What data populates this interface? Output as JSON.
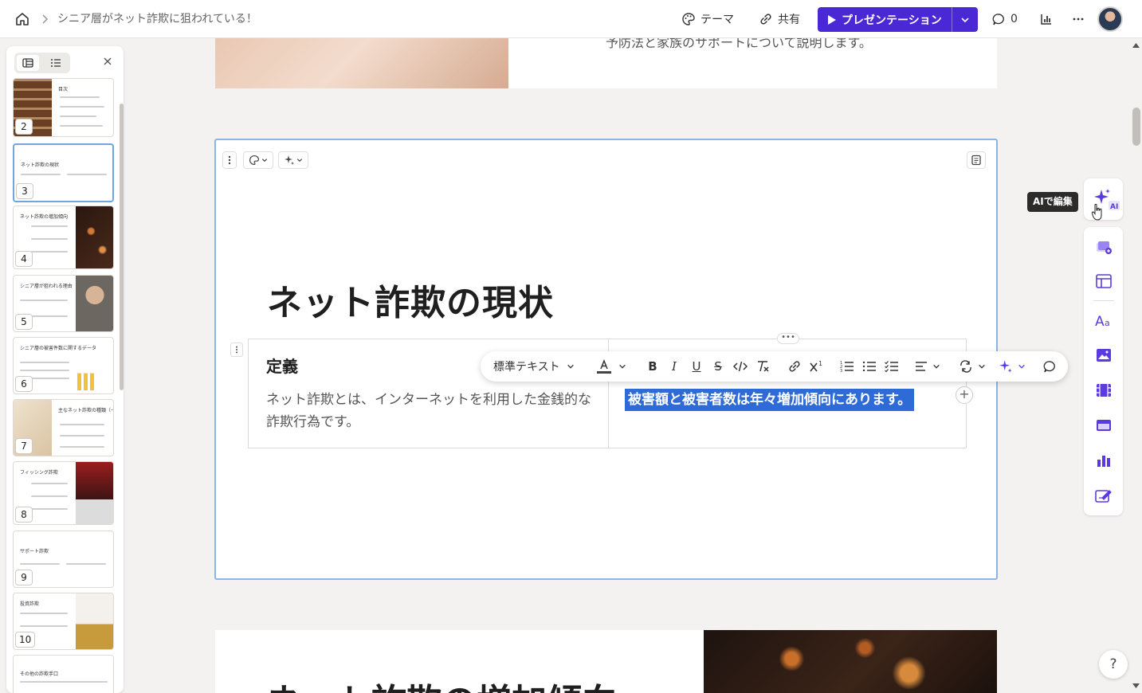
{
  "header": {
    "breadcrumb_title": "シニア層がネット詐欺に狙われている！",
    "theme_label": "テーマ",
    "share_label": "共有",
    "present_label": "プレゼンテーション",
    "comment_count": "0"
  },
  "thumbnails": [
    {
      "num": "2",
      "title": "目次"
    },
    {
      "num": "3",
      "title": "ネット詐欺の現状"
    },
    {
      "num": "4",
      "title": "ネット詐欺の増加傾向"
    },
    {
      "num": "5",
      "title": "シニア層が狙われる理由"
    },
    {
      "num": "6",
      "title": "シニア層の被害件数に関するデータ"
    },
    {
      "num": "7",
      "title": "主なネット詐欺の種類（イントロ）"
    },
    {
      "num": "8",
      "title": "フィッシング詐欺"
    },
    {
      "num": "9",
      "title": "サポート詐欺"
    },
    {
      "num": "10",
      "title": "投資詐欺"
    },
    {
      "num": "",
      "title": "その他の詐欺手口"
    }
  ],
  "slide_prev": {
    "text": "予防法と家族のサポートについて説明します。"
  },
  "slide": {
    "title": "ネット詐欺の現状",
    "col1_heading": "定義",
    "col1_body": "ネット詐欺とは、インターネットを利用した金銭的な詐欺行為です。",
    "col2_selected": "被害額と被害者数は年々増加傾向にあります。"
  },
  "format_toolbar": {
    "text_style": "標準テキスト"
  },
  "tooltip": {
    "text": "AIで編集"
  },
  "slide_next": {
    "title": "ネット詐欺の増加傾向"
  },
  "help_label": "?",
  "colors": {
    "accent": "#4a28d6",
    "selection": "#2f6bd6",
    "ai_icon": "#5b3be0"
  }
}
